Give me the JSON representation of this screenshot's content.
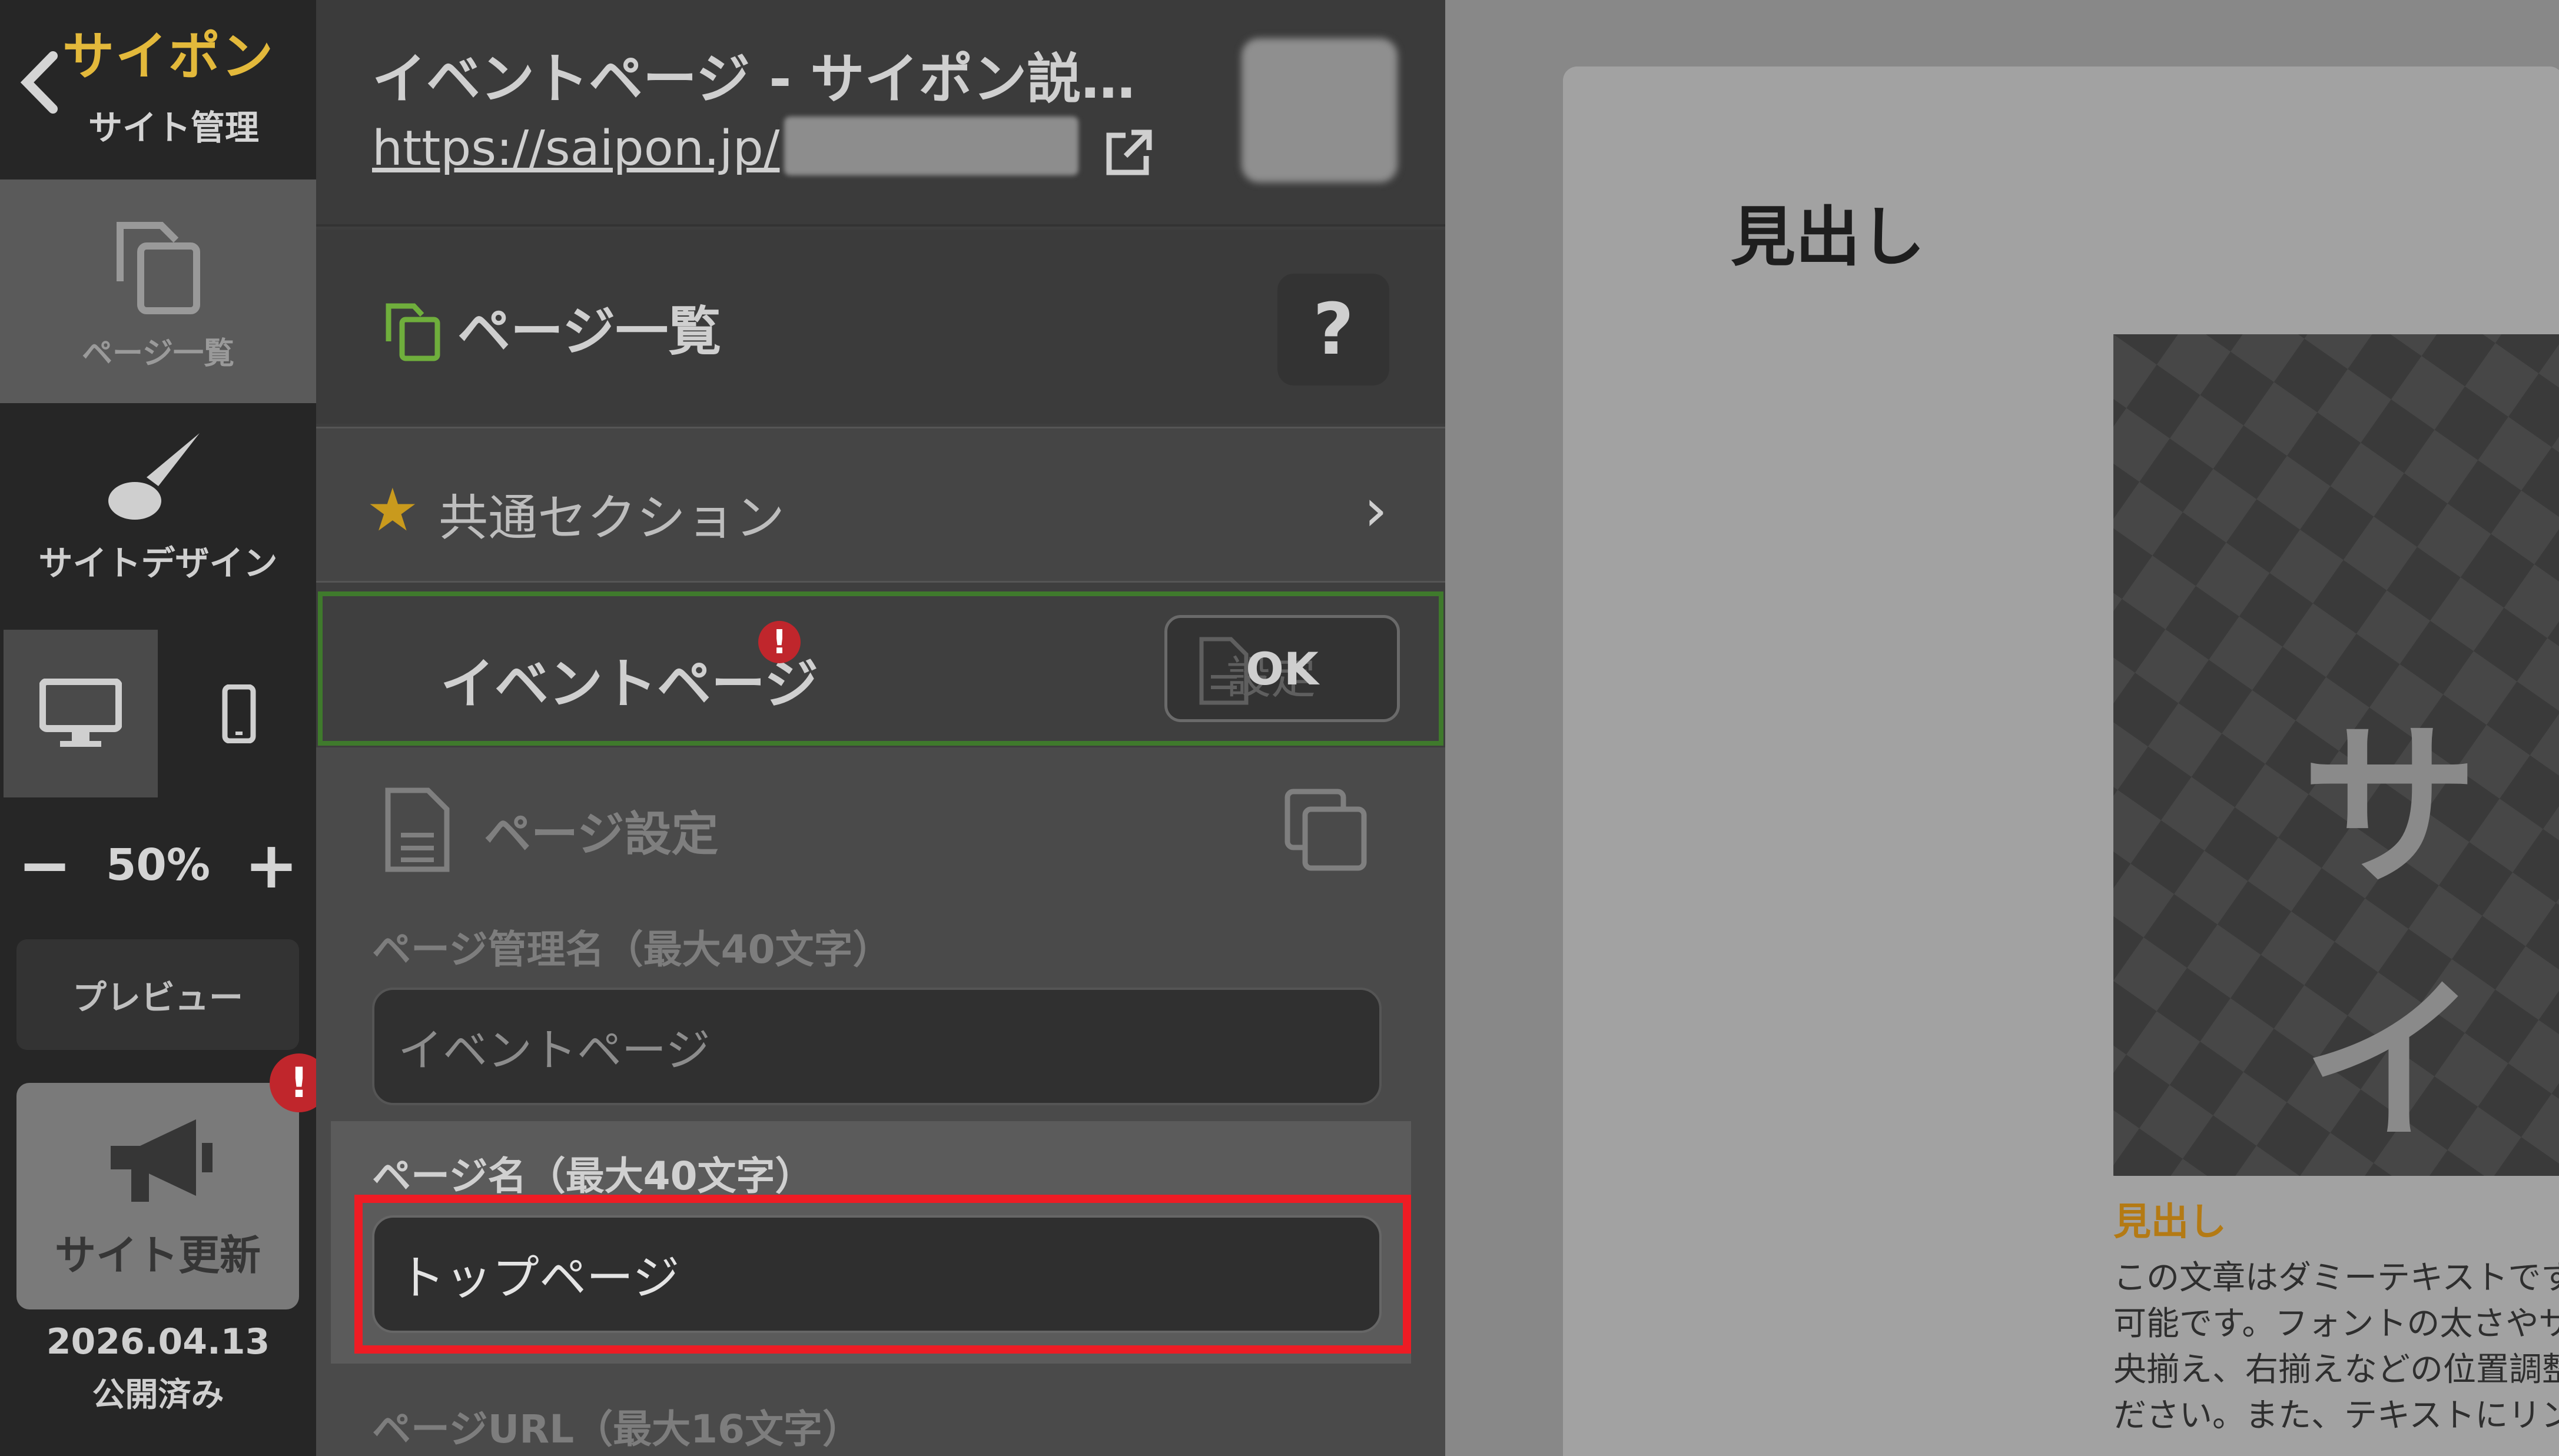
{
  "brand": {
    "logo": "サイポン",
    "subtitle": "サイト管理"
  },
  "rail": {
    "pages_label": "ページ一覧",
    "design_label": "サイトデザイン",
    "zoom_minus": "−",
    "zoom_value": "50%",
    "zoom_plus": "+",
    "preview_label": "プレビュー",
    "update_label": "サイト更新",
    "update_alert": "!",
    "published_date": "2026.04.13",
    "published_status": "公開済み"
  },
  "panel": {
    "title": "イベントページ - サイポン説…",
    "url": "https://saipon.jp/",
    "list_title": "ページ一覧",
    "help_label": "?",
    "common_section": "共通セクション",
    "current_page": "イベントページ",
    "current_alert": "!",
    "ok_label": "OK",
    "ok_ghost": "設定",
    "settings_title": "ページ設定",
    "admin_name_label": "ページ管理名（最大40文字）",
    "admin_name_value": "イベントページ",
    "page_name_label": "ページ名（最大40文字）",
    "page_name_value": "トップページ",
    "page_url_label": "ページURL（最大16文字）"
  },
  "preview": {
    "heading": "見出し",
    "hero_text": "サイ",
    "subheading": "見出し",
    "body_lines": [
      "この文章はダミーテキストです",
      "可能です。フォントの太さやサ",
      "央揃え、右揃えなどの位置調整",
      "ださい。また、テキストにリン"
    ]
  },
  "colors": {
    "accent_green": "#3f7a2c",
    "alert_red": "#c0262c",
    "highlight_red": "#ee1c24",
    "star_gold": "#c99a1d",
    "subheading_gold": "#b47a14"
  }
}
